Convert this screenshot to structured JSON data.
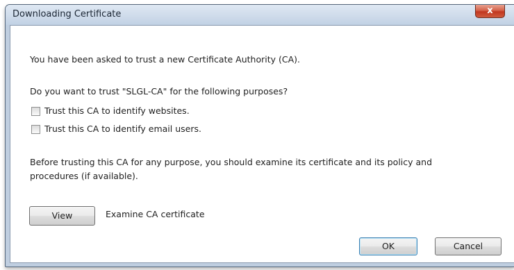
{
  "window": {
    "title": "Downloading Certificate",
    "close_label": "x"
  },
  "dialog": {
    "intro": "You have been asked to trust a new Certificate Authority (CA).",
    "question": "Do you want to trust \"SLGL-CA\" for the following purposes?",
    "options": [
      {
        "label": "Trust this CA to identify websites.",
        "checked": false
      },
      {
        "label": "Trust this CA to identify email users.",
        "checked": false
      }
    ],
    "advice_line1": "Before trusting this CA for any purpose, you should examine its certificate and its policy and",
    "advice_line2": "procedures (if available).",
    "view_button": "View",
    "view_description": "Examine CA certificate",
    "ok_button": "OK",
    "cancel_button": "Cancel"
  },
  "colors": {
    "frame": "#bfcee0",
    "close_button": "#c9452d",
    "default_button_border": "#3c7fb1"
  }
}
